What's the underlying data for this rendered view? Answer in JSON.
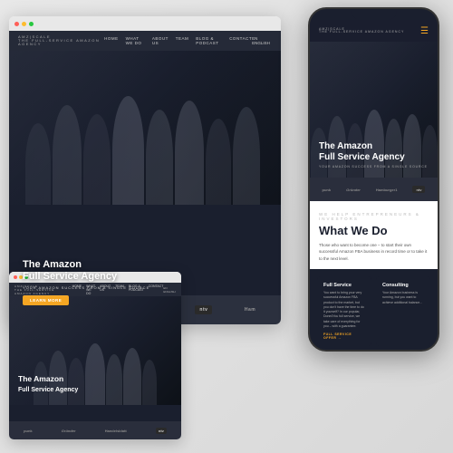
{
  "brand": {
    "name": "AMZ|SCALE",
    "tagline": "THE FULL-SERVICE AMAZON AGENCY"
  },
  "nav": {
    "links": [
      "HOME",
      "WHAT WE DO",
      "ABOUT US",
      "TEAM",
      "BLOG & PODCAST",
      "CONTACT"
    ],
    "lang": "EN ENGLISH"
  },
  "hero": {
    "headline_line1": "The Amazon",
    "headline_line2": "Full Service Agency",
    "subheadline": "YOUR AMAZON SUCCESS FROM A SINGLE SOURCE",
    "cta_label": "LEARN MORE"
  },
  "logo_bar": {
    "items": [
      "punk",
      "Handelsblatt",
      "ntv",
      "Ham"
    ]
  },
  "phone": {
    "what_we_do": {
      "eyebrow": "WE HELP ENTREPRENEURS & INVESTORS",
      "title": "What We Do",
      "description": "Those who want to become one – to start their own successful Amazon FBA business in record time or to take it to the next level."
    },
    "logo_bar_items": [
      "punk",
      "Handelsblatt",
      "ntv"
    ],
    "cards": [
      {
        "title": "Full Service",
        "text": "You want to bring your very successful Amazon FBA product to the market, but you don't have the time to do it yourself? In our popular, Done4You full service, we take care of everything for you – with a guarantee.",
        "link": "FULL SERVICE OFFER →"
      },
      {
        "title": "Consulting",
        "text": "Your Amazon business is running, but you want to achieve additional balance...",
        "link": ""
      }
    ]
  },
  "hamburger_icon": "☰",
  "colors": {
    "accent": "#f5a623",
    "dark_bg": "#1a1f2e",
    "text_light": "#ffffff",
    "text_muted": "#999999"
  }
}
